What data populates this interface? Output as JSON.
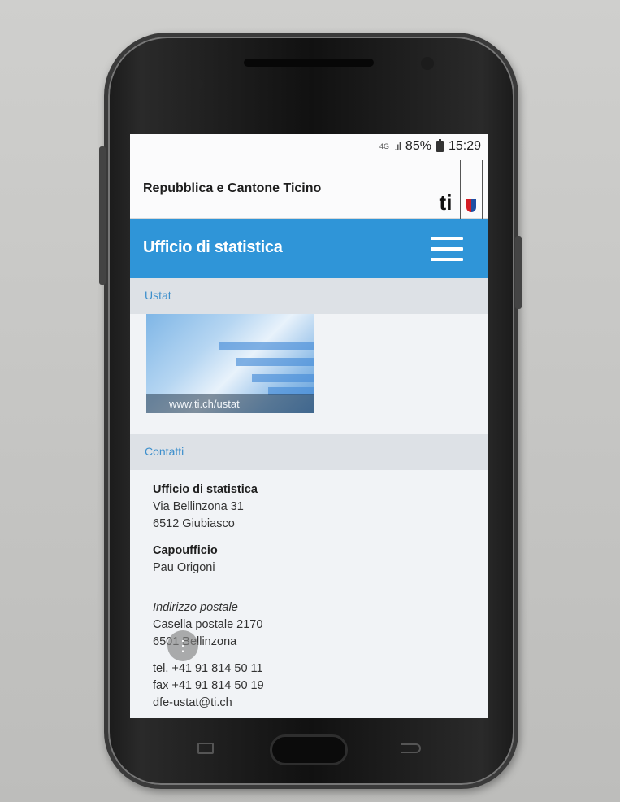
{
  "status_bar": {
    "network": "4G",
    "signal": ".ıl",
    "battery": "85%",
    "time": "15:29"
  },
  "header": {
    "brand": "Repubblica e Cantone Ticino",
    "logo_text": "ti"
  },
  "titlebar": {
    "title": "Ufficio di statistica"
  },
  "sections": {
    "ustat": {
      "heading": "Ustat",
      "banner_caption": "www.ti.ch/ustat"
    },
    "contatti": {
      "heading": "Contatti",
      "office_name": "Ufficio di statistica",
      "street": "Via Bellinzona 31",
      "city": "6512 Giubiasco",
      "head_label": "Capoufficio",
      "head_name": "Pau Origoni",
      "postal_label": "Indirizzo postale",
      "postal_box": "Casella postale 2170",
      "postal_city": "6501 Bellinzona",
      "tel": "tel. +41 91 814 50 11",
      "fax": "fax +41 91 814 50 19",
      "email": "dfe-ustat@ti.ch"
    }
  },
  "colors": {
    "accent": "#2f95d8",
    "section_heading": "#3d8fcc"
  }
}
